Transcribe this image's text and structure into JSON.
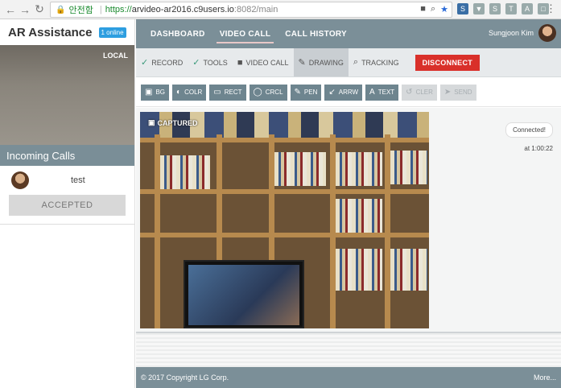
{
  "browser": {
    "secure_label": "안전함",
    "url_scheme": "https://",
    "url_host": "arvideo-ar2016.c9users.io",
    "url_path": ":8082/main"
  },
  "sidebar": {
    "brand": "AR Assistance",
    "online_badge": "1 online",
    "local_label": "LOCAL",
    "incoming_title": "Incoming Calls",
    "caller_name": "test",
    "accepted_label": "ACCEPTED"
  },
  "topnav": {
    "items": [
      "DASHBOARD",
      "VIDEO CALL",
      "CALL HISTORY"
    ],
    "active_index": 1,
    "user_name": "Sungjoon Kim"
  },
  "toolbar1": {
    "items": [
      {
        "label": "RECORD",
        "icon": "check-icon"
      },
      {
        "label": "TOOLS",
        "icon": "check-icon"
      },
      {
        "label": "VIDEO CALL",
        "icon": "video-camera-icon"
      },
      {
        "label": "DRAWING",
        "icon": "pencil-icon"
      },
      {
        "label": "TRACKING",
        "icon": "search-icon"
      }
    ],
    "disconnect_label": "DISCONNECT"
  },
  "toolbar2": {
    "tools": [
      {
        "label": "BG",
        "icon": "image-icon",
        "enabled": true
      },
      {
        "label": "COLR",
        "icon": "contrast-icon",
        "enabled": true
      },
      {
        "label": "RECT",
        "icon": "rectangle-icon",
        "enabled": true
      },
      {
        "label": "CRCL",
        "icon": "circle-icon",
        "enabled": true
      },
      {
        "label": "PEN",
        "icon": "pen-icon",
        "enabled": true
      },
      {
        "label": "ARRW",
        "icon": "arrow-icon",
        "enabled": true
      },
      {
        "label": "TEXT",
        "icon": "text-icon",
        "enabled": true
      },
      {
        "label": "CLER",
        "icon": "undo-icon",
        "enabled": false
      },
      {
        "label": "SEND",
        "icon": "send-icon",
        "enabled": false
      }
    ]
  },
  "main": {
    "captured_label": "CAPTURED",
    "chat_message": "Connected!",
    "chat_time": "at 1:00:22"
  },
  "footer": {
    "copyright": "© 2017 Copyright LG Corp.",
    "more": "More..."
  },
  "colors": {
    "nav_bg": "#7b8f98",
    "tool_btn": "#6e858f",
    "disconnect": "#d9302a",
    "online_badge": "#2d9ee0"
  }
}
